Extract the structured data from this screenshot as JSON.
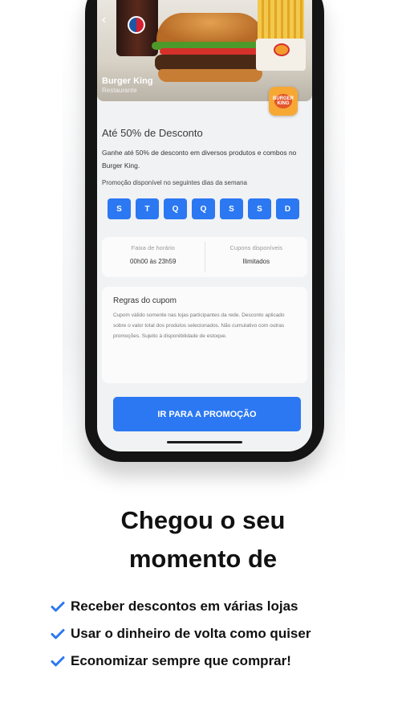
{
  "hero": {
    "back_icon": "chevron-left-icon",
    "store_name": "Burger King",
    "store_category": "Restaurante",
    "badge_text": "BURGER KING"
  },
  "offer": {
    "title": "Até 50% de Desconto",
    "description": "Ganhe até 50% de desconto em diversos produtos e combos no Burger King.",
    "availability": "Promoção disponível no seguintes dias da semana",
    "days": [
      "S",
      "T",
      "Q",
      "Q",
      "S",
      "S",
      "D"
    ]
  },
  "info": {
    "time_label": "Faixa de horário",
    "time_value": "00h00 às 23h59",
    "coupon_label": "Cupons disponíveis",
    "coupon_value": "Ilimitados"
  },
  "rules": {
    "title": "Regras do cupom",
    "text": "Cupom válido somente nas lojas participantes da rede. Desconto aplicado sobre o valor total dos produtos selecionados. Não cumulativo com outras promoções. Sujeito à disponibilidade de estoque."
  },
  "cta": {
    "label": "IR PARA A PROMOÇÃO"
  },
  "marketing": {
    "headline_line1": "Chegou o seu",
    "headline_line2": "momento de",
    "items": [
      "Receber descontos em várias lojas",
      "Usar o dinheiro de volta como quiser",
      "Economizar sempre que comprar!"
    ],
    "check_color": "#2b78f2"
  }
}
